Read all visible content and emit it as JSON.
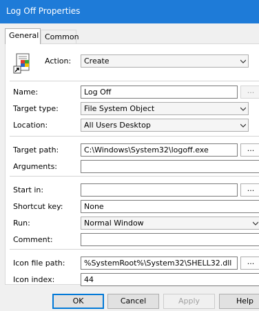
{
  "window": {
    "title": "Log Off Properties"
  },
  "tabs": [
    {
      "label": "General"
    },
    {
      "label": "Common"
    }
  ],
  "form": {
    "action": {
      "label": "Action:",
      "value": "Create"
    },
    "name": {
      "label": "Name:",
      "value": "Log Off",
      "browse": "..."
    },
    "target_type": {
      "label": "Target type:",
      "value": "File System Object"
    },
    "location": {
      "label": "Location:",
      "value": "All Users Desktop"
    },
    "target_path": {
      "label": "Target path:",
      "value": "C:\\Windows\\System32\\logoff.exe",
      "browse": "..."
    },
    "arguments": {
      "label": "Arguments:",
      "value": ""
    },
    "start_in": {
      "label": "Start in:",
      "value": "",
      "browse": "..."
    },
    "shortcut_key": {
      "label": "Shortcut key:",
      "value": "None"
    },
    "run": {
      "label": "Run:",
      "value": "Normal Window"
    },
    "comment": {
      "label": "Comment:",
      "value": ""
    },
    "icon_file_path": {
      "label": "Icon file path:",
      "value": "%SystemRoot%\\System32\\SHELL32.dll",
      "browse": "..."
    },
    "icon_index": {
      "label": "Icon index:",
      "value": "44"
    }
  },
  "buttons": {
    "ok": "OK",
    "cancel": "Cancel",
    "apply": "Apply",
    "help": "Help"
  },
  "colors": {
    "titlebar": "#1e7bd8",
    "accent": "#0078d7",
    "dialog_bg": "#f0f0f0"
  },
  "icons": {
    "shortcut": "shortcut-app-icon",
    "dropdown": "chevron-down-icon"
  }
}
